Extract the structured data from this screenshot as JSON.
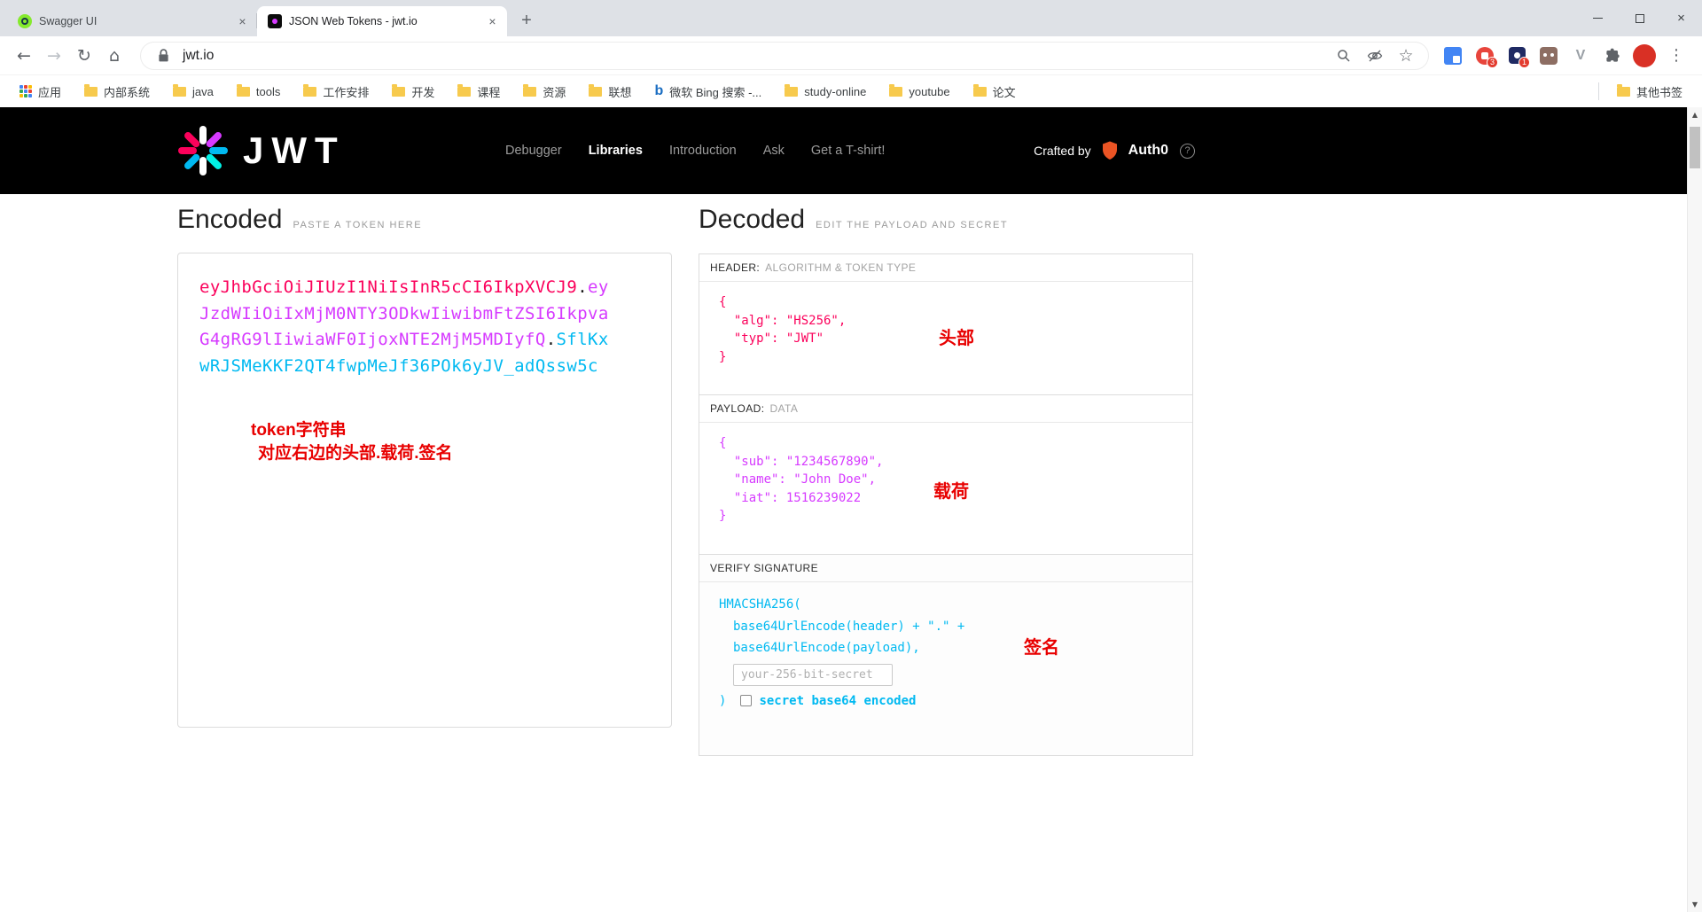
{
  "colors": {
    "token_header": "#fb015b",
    "token_payload": "#d63aff",
    "token_signature": "#00b9f1",
    "annotation": "#e80000",
    "site_header_bg": "#000000"
  },
  "icons": {
    "back": "←",
    "forward": "→",
    "reload": "↻",
    "home": "⌂",
    "star": "☆",
    "menu": "⋮",
    "new_tab": "+",
    "close": "×",
    "close_window": "×",
    "scroll_up": "▲",
    "scroll_down": "▼",
    "help": "?",
    "v_extension": "V"
  },
  "tabs": {
    "items": [
      {
        "title": "Swagger UI"
      },
      {
        "title": "JSON Web Tokens - jwt.io"
      }
    ]
  },
  "toolbar": {
    "url": "jwt.io",
    "extension_badges": {
      "red": "3",
      "dark": "1"
    }
  },
  "bookmarks_bar": {
    "apps_label": "应用",
    "items": [
      "内部系统",
      "java",
      "tools",
      "工作安排",
      "开发",
      "课程",
      "资源",
      "联想",
      "微软 Bing 搜索 -...",
      "study-online",
      "youtube",
      "论文"
    ],
    "other_bookmarks": "其他书签"
  },
  "site_header": {
    "logo_text": "JWT",
    "nav": [
      {
        "label": "Debugger"
      },
      {
        "label": "Libraries"
      },
      {
        "label": "Introduction"
      },
      {
        "label": "Ask"
      },
      {
        "label": "Get a T-shirt!"
      }
    ],
    "crafted_by": "Crafted by",
    "auth0": "Auth0"
  },
  "encoded": {
    "title": "Encoded",
    "subtitle": "PASTE A TOKEN HERE",
    "token": {
      "header": "eyJhbGciOiJIUzI1NiIsInR5cCI6IkpXVCJ9",
      "dot1": ".",
      "payload": "eyJzdWIiOiIxMjM0NTY3ODkwIiwibmFtZSI6IkpvaG4gRG9lIiwiaWF0IjoxNTE2MjM5MDIyfQ",
      "dot2": ".",
      "signature": "SflKxwRJSMeKKF2QT4fwpMeJf36POk6yJV_adQssw5c"
    },
    "annotation": {
      "line1": "token字符串",
      "line2": "对应右边的头部.载荷.签名"
    }
  },
  "decoded": {
    "title": "Decoded",
    "subtitle": "EDIT THE PAYLOAD AND SECRET",
    "header": {
      "label": "HEADER:",
      "sublabel": "ALGORITHM & TOKEN TYPE",
      "lines": [
        "{",
        "  \"alg\": \"HS256\",",
        "  \"typ\": \"JWT\"",
        "}"
      ],
      "annotation": "头部"
    },
    "payload": {
      "label": "PAYLOAD:",
      "sublabel": "DATA",
      "lines": [
        "{",
        "  \"sub\": \"1234567890\",",
        "  \"name\": \"John Doe\",",
        "  \"iat\": 1516239022",
        "}"
      ],
      "annotation": "载荷"
    },
    "signature": {
      "label": "VERIFY SIGNATURE",
      "lines": [
        "HMACSHA256(",
        "base64UrlEncode(header) + \".\" +",
        "base64UrlEncode(payload),"
      ],
      "close_paren": ")",
      "secret_placeholder": "your-256-bit-secret",
      "checkbox_label": "secret base64 encoded",
      "annotation": "签名"
    }
  }
}
